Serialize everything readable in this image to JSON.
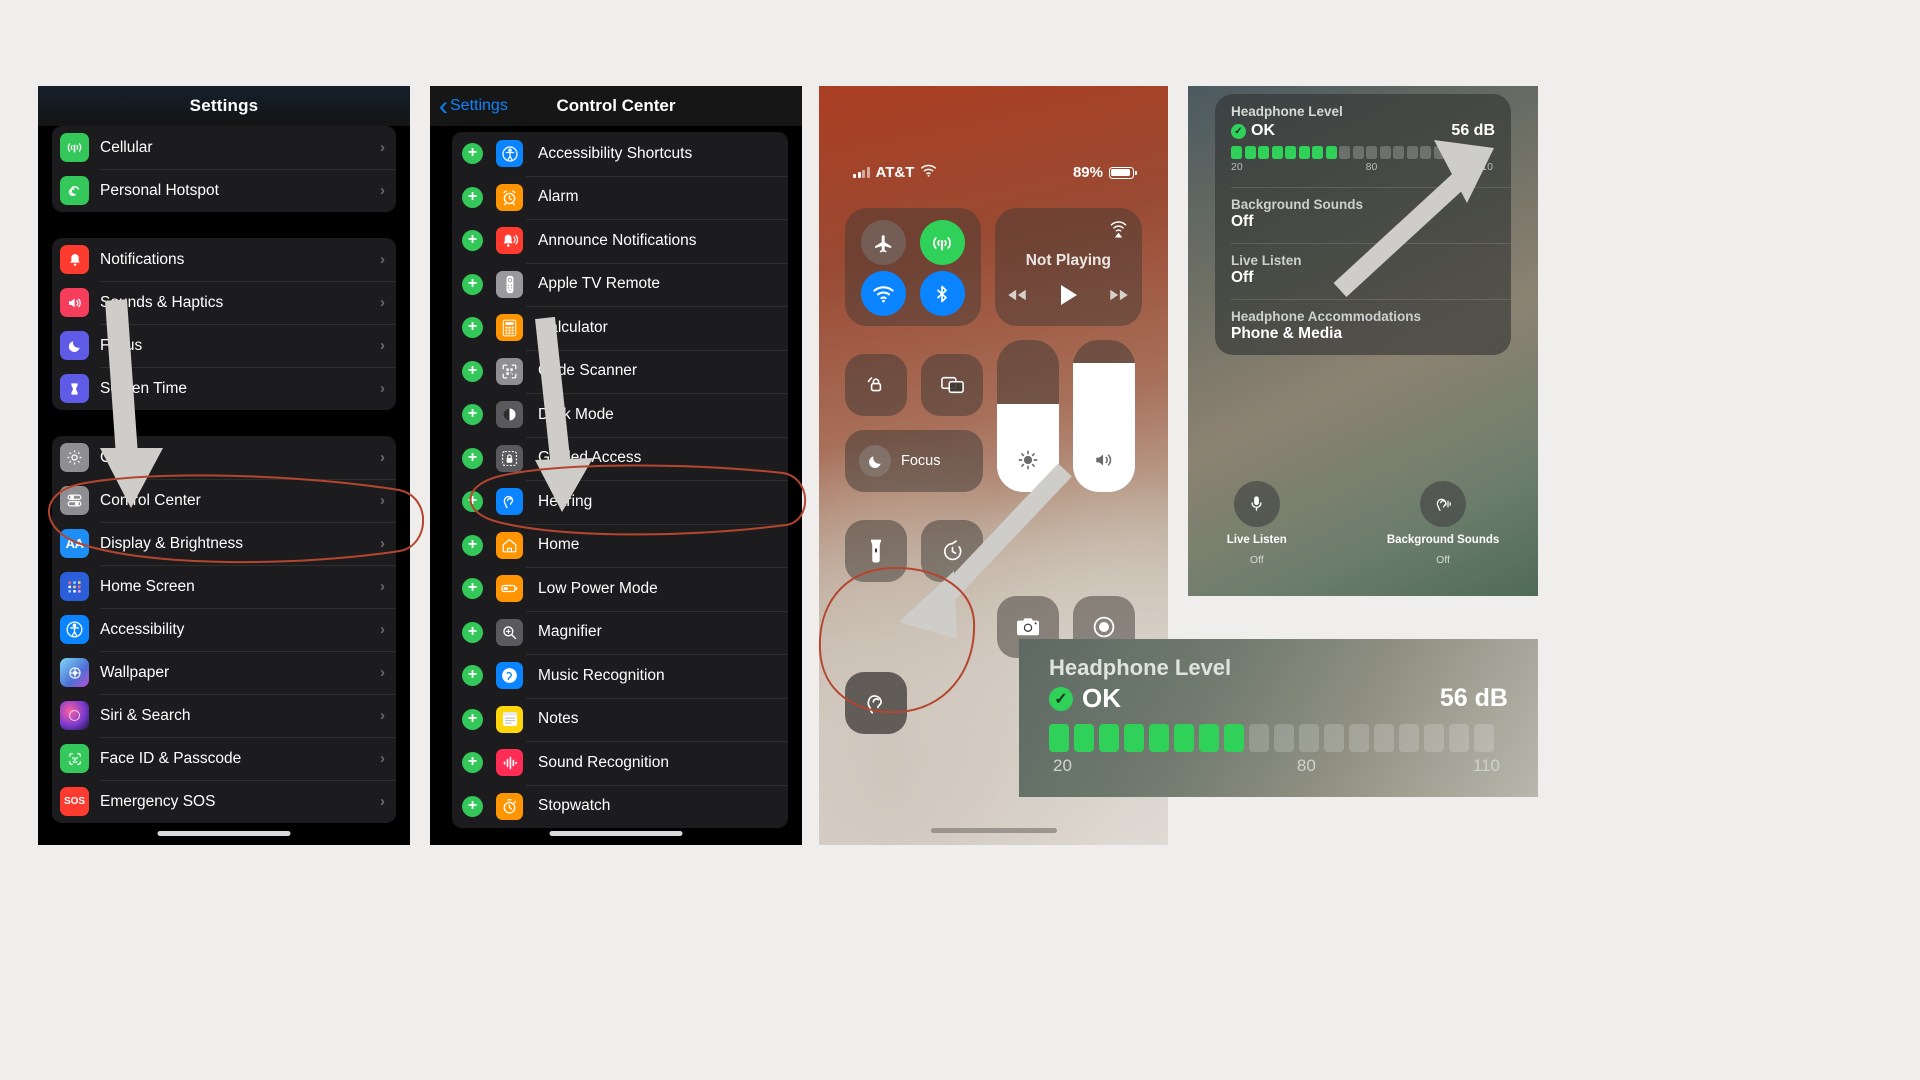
{
  "panel_settings": {
    "title": "Settings",
    "groups": [
      {
        "rows": [
          {
            "label": "Cellular",
            "icon": "cellular-icon",
            "color": "#34c759"
          },
          {
            "label": "Personal Hotspot",
            "icon": "hotspot-icon",
            "color": "#34c759"
          }
        ]
      },
      {
        "rows": [
          {
            "label": "Notifications",
            "icon": "notifications-icon",
            "color": "#ff3b30"
          },
          {
            "label": "Sounds & Haptics",
            "icon": "sounds-icon",
            "color": "#f73d5c"
          },
          {
            "label": "Focus",
            "icon": "focus-icon",
            "color": "#5e5ce6"
          },
          {
            "label": "Screen Time",
            "icon": "screen-time-icon",
            "color": "#5e5ce6"
          }
        ]
      },
      {
        "rows": [
          {
            "label": "General",
            "icon": "gear-icon",
            "color": "#8e8e93"
          },
          {
            "label": "Control Center",
            "icon": "control-center-icon",
            "color": "#8e8e93"
          },
          {
            "label": "Display & Brightness",
            "icon": "display-brightness-icon",
            "color": "#1c8ef5"
          },
          {
            "label": "Home Screen",
            "icon": "home-screen-icon",
            "color": "#2b5fd9"
          },
          {
            "label": "Accessibility",
            "icon": "accessibility-icon",
            "color": "#0a84ff"
          },
          {
            "label": "Wallpaper",
            "icon": "wallpaper-icon",
            "color": "#4f9ad6"
          },
          {
            "label": "Siri & Search",
            "icon": "siri-icon",
            "color": "#3b2a52"
          },
          {
            "label": "Face ID & Passcode",
            "icon": "face-id-icon",
            "color": "#34c759"
          },
          {
            "label": "Emergency SOS",
            "icon": "sos-icon",
            "color": "#ff3b30"
          }
        ]
      }
    ]
  },
  "panel_control_center_settings": {
    "back_label": "Settings",
    "title": "Control Center",
    "rows": [
      {
        "label": "Accessibility Shortcuts",
        "icon": "accessibility-icon",
        "color": "#0a84ff",
        "action": "add"
      },
      {
        "label": "Alarm",
        "icon": "alarm-icon",
        "color": "#ff9500",
        "action": "add"
      },
      {
        "label": "Announce Notifications",
        "icon": "announce-notifications-icon",
        "color": "#ff3b30",
        "action": "add"
      },
      {
        "label": "Apple TV Remote",
        "icon": "apple-tv-remote-icon",
        "color": "#9a9a9e",
        "action": "add"
      },
      {
        "label": "Calculator",
        "icon": "calculator-icon",
        "color": "#ff9500",
        "action": "add"
      },
      {
        "label": "Code Scanner",
        "icon": "code-scanner-icon",
        "color": "#8e8e93",
        "action": "add"
      },
      {
        "label": "Dark Mode",
        "icon": "dark-mode-icon",
        "color": "#5a5a5e",
        "action": "add"
      },
      {
        "label": "Guided Access",
        "icon": "guided-access-icon",
        "color": "#5a5a5e",
        "action": "add"
      },
      {
        "label": "Hearing",
        "icon": "hearing-icon",
        "color": "#0a84ff",
        "action": "add"
      },
      {
        "label": "Home",
        "icon": "home-icon",
        "color": "#ff9500",
        "action": "add"
      },
      {
        "label": "Low Power Mode",
        "icon": "low-power-mode-icon",
        "color": "#ff9500",
        "action": "add"
      },
      {
        "label": "Magnifier",
        "icon": "magnifier-icon",
        "color": "#5a5a5e",
        "action": "add"
      },
      {
        "label": "Music Recognition",
        "icon": "music-recognition-icon",
        "color": "#0a84ff",
        "action": "add"
      },
      {
        "label": "Notes",
        "icon": "notes-icon",
        "color": "#ffd60a",
        "action": "add"
      },
      {
        "label": "Sound Recognition",
        "icon": "sound-recognition-icon",
        "color": "#ff2d55",
        "action": "add"
      },
      {
        "label": "Stopwatch",
        "icon": "stopwatch-icon",
        "color": "#ff9500",
        "action": "add"
      }
    ]
  },
  "panel_control_center": {
    "status": {
      "carrier": "AT&T",
      "battery_percent": "89%",
      "signal_icon": "cellular-bars-icon",
      "wifi_icon": "wifi-icon",
      "battery_icon": "battery-icon"
    },
    "connectivity": {
      "airplane_icon": "airplane-mode-icon",
      "cellular_icon": "cellular-data-icon",
      "wifi_icon": "wifi-toggle-icon",
      "bluetooth_icon": "bluetooth-icon"
    },
    "now_playing": {
      "title": "Not Playing",
      "airplay_icon": "airplay-icon",
      "prev_icon": "rewind-icon",
      "play_icon": "play-icon",
      "next_icon": "fast-forward-icon"
    },
    "tiles": {
      "rotation_lock_icon": "rotation-lock-icon",
      "screen_mirroring_icon": "screen-mirroring-icon",
      "focus_label": "Focus",
      "focus_icon": "moon-icon",
      "brightness_icon": "brightness-icon",
      "volume_icon": "volume-icon",
      "flashlight_icon": "flashlight-icon",
      "timer_icon": "timer-icon",
      "camera_icon": "camera-icon",
      "screen_record_icon": "screen-record-icon",
      "hearing_icon": "hearing-ear-icon"
    }
  },
  "panel_hearing": {
    "headphone_level": {
      "heading": "Headphone Level",
      "status": "OK",
      "value": "56 dB",
      "check_icon": "check-circle-icon",
      "scale_low": "20",
      "scale_mid": "80",
      "scale_high": "110",
      "segments_total": 18,
      "segments_on": 8
    },
    "background_sounds": {
      "label": "Background Sounds",
      "value": "Off"
    },
    "live_listen": {
      "label": "Live Listen",
      "value": "Off"
    },
    "headphone_accommodations": {
      "label": "Headphone Accommodations",
      "value": "Phone & Media"
    },
    "buttons": [
      {
        "label": "Live Listen",
        "sub": "Off",
        "icon": "microphone-icon"
      },
      {
        "label": "Background Sounds",
        "sub": "Off",
        "icon": "background-sounds-icon"
      }
    ]
  },
  "panel_headphone_zoom": {
    "heading": "Headphone Level",
    "status": "OK",
    "value": "56 dB",
    "check_icon": "check-circle-icon",
    "scale_low": "20",
    "scale_mid": "80",
    "scale_high": "110",
    "segments_total": 18,
    "segments_on": 8
  },
  "annotations": {
    "arrow_color": "#cfcdc9",
    "circle_color": "#b4452e",
    "arrows": [
      "settings-to-control-center",
      "list-to-hearing",
      "cc-to-hearing-tile",
      "inset-to-headphone-level"
    ],
    "circles": [
      "control-center-row-circle",
      "hearing-row-circle",
      "hearing-tile-circle"
    ]
  }
}
